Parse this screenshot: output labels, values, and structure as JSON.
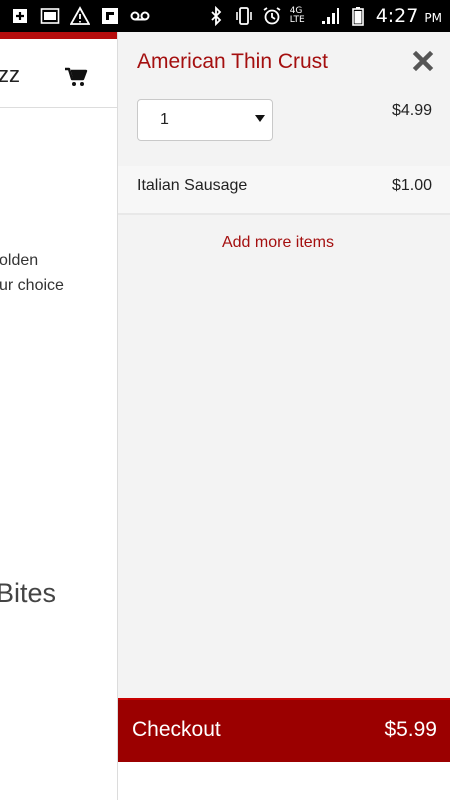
{
  "status_bar": {
    "time": "4:27",
    "ampm": "PM",
    "network": "4G LTE",
    "icons": [
      "add-icon",
      "gallery-icon",
      "warning-icon",
      "flipboard-icon",
      "voicemail-icon",
      "bluetooth-icon",
      "vibrate-icon",
      "alarm-icon",
      "signal-icon",
      "battery-icon"
    ]
  },
  "background_page": {
    "header_text": "zz",
    "description_lines": [
      "olden",
      "ur choice"
    ],
    "section_title": "Bites",
    "accent_color": "#b50d0d"
  },
  "cart": {
    "item": {
      "title": "American Thin Crust",
      "quantity": "1",
      "price": "$4.99"
    },
    "toppings": [
      {
        "name": "Italian Sausage",
        "price": "$1.00"
      }
    ],
    "add_more_label": "Add more items",
    "checkout": {
      "label": "Checkout",
      "total": "$5.99"
    },
    "colors": {
      "brand": "#a40f0f",
      "checkout_bg": "#9b0000"
    }
  }
}
